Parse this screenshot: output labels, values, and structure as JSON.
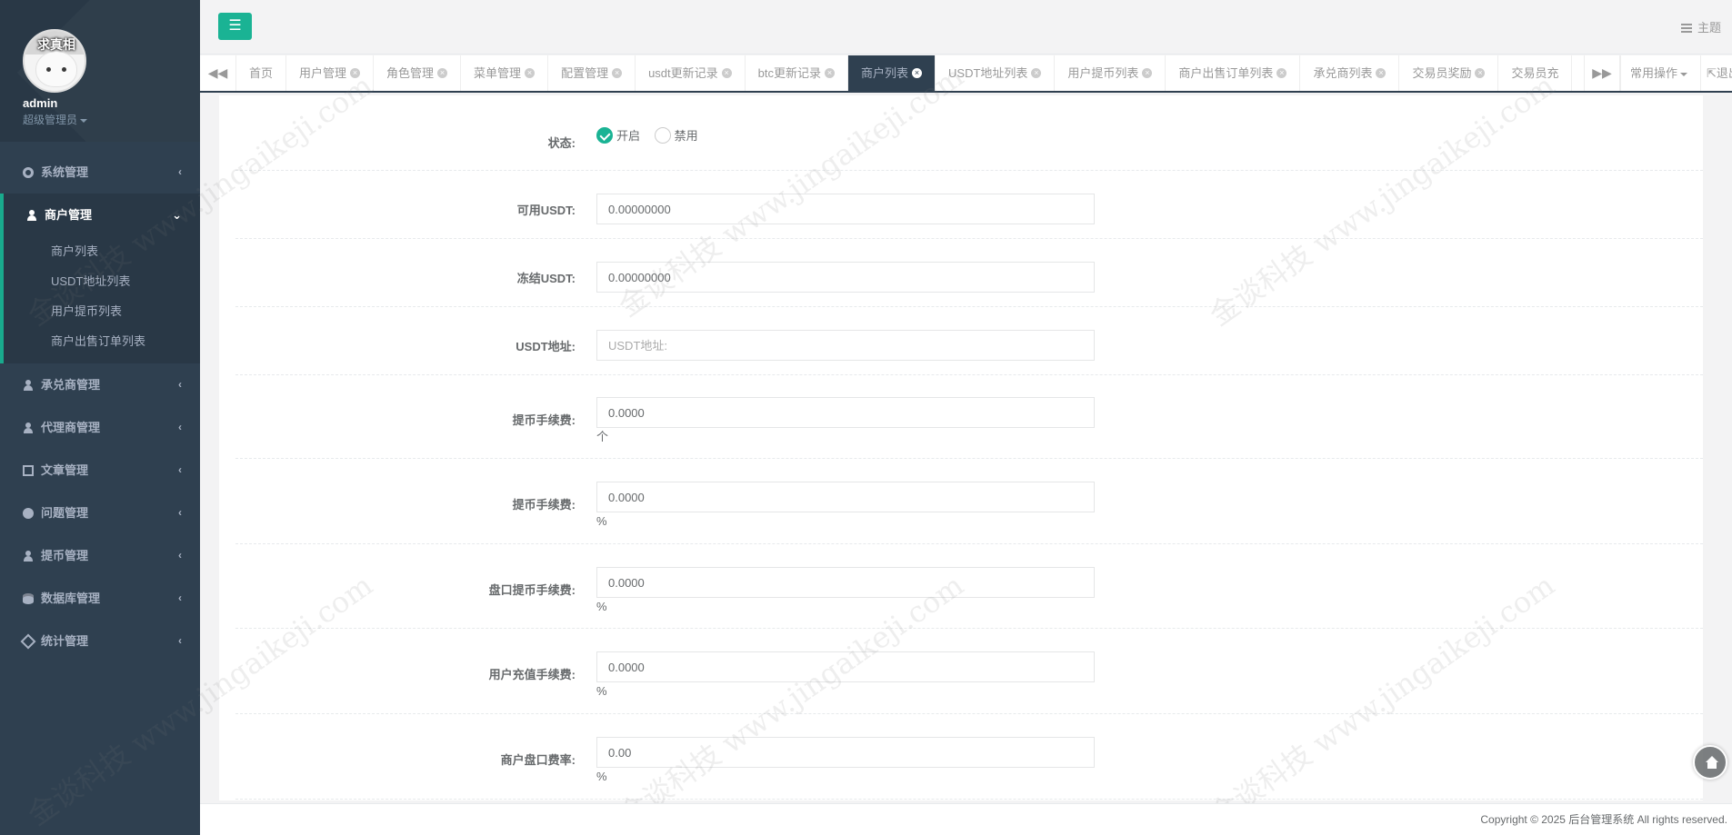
{
  "sidebar": {
    "avatar_name": "求真相",
    "user_name": "admin",
    "user_role": "超级管理员",
    "items": [
      {
        "label": "系统管理",
        "icon": "gear-icon"
      },
      {
        "label": "商户管理",
        "icon": "user-icon",
        "open": true,
        "children": [
          "商户列表",
          "USDT地址列表",
          "用户提币列表",
          "商户出售订单列表"
        ]
      },
      {
        "label": "承兑商管理",
        "icon": "user-icon"
      },
      {
        "label": "代理商管理",
        "icon": "user-icon"
      },
      {
        "label": "文章管理",
        "icon": "copy-icon"
      },
      {
        "label": "问题管理",
        "icon": "chat-icon"
      },
      {
        "label": "提币管理",
        "icon": "user-icon"
      },
      {
        "label": "数据库管理",
        "icon": "database-icon"
      },
      {
        "label": "统计管理",
        "icon": "cube-icon"
      }
    ]
  },
  "topbar": {
    "theme_label": "主题"
  },
  "tabs": {
    "items": [
      "首页",
      "用户管理",
      "角色管理",
      "菜单管理",
      "配置管理",
      "usdt更新记录",
      "btc更新记录",
      "商户列表",
      "USDT地址列表",
      "用户提币列表",
      "商户出售订单列表",
      "承兑商列表",
      "交易员奖励",
      "交易员充"
    ],
    "active_index": 7,
    "more_label": "常用操作",
    "logout_label": "退出"
  },
  "form": {
    "status": {
      "label": "状态:",
      "options": [
        "开启",
        "禁用"
      ],
      "selected": "开启"
    },
    "available_usdt": {
      "label": "可用USDT:",
      "value": "0.00000000"
    },
    "frozen_usdt": {
      "label": "冻结USDT:",
      "value": "0.00000000"
    },
    "usdt_address": {
      "label": "USDT地址:",
      "value": "",
      "placeholder": "USDT地址:"
    },
    "withdraw_fee_fixed": {
      "label": "提币手续费:",
      "value": "0.0000",
      "unit": "个"
    },
    "withdraw_fee_pct": {
      "label": "提币手续费:",
      "value": "0.0000",
      "unit": "%"
    },
    "market_withdraw_fee": {
      "label": "盘口提币手续费:",
      "value": "0.0000",
      "unit": "%"
    },
    "user_recharge_fee": {
      "label": "用户充值手续费:",
      "value": "0.0000",
      "unit": "%"
    },
    "merchant_market_rate": {
      "label": "商户盘口费率:",
      "value": "0.00",
      "unit": "%"
    }
  },
  "footer": {
    "copyright": "Copyright © 2025 后台管理系统 All rights reserved."
  },
  "watermark": "金谈科技 www.jingaikeji.com",
  "colors": {
    "sidebar_bg": "#2f4050",
    "accent": "#1ab394",
    "active_tab": "#2f4050"
  }
}
